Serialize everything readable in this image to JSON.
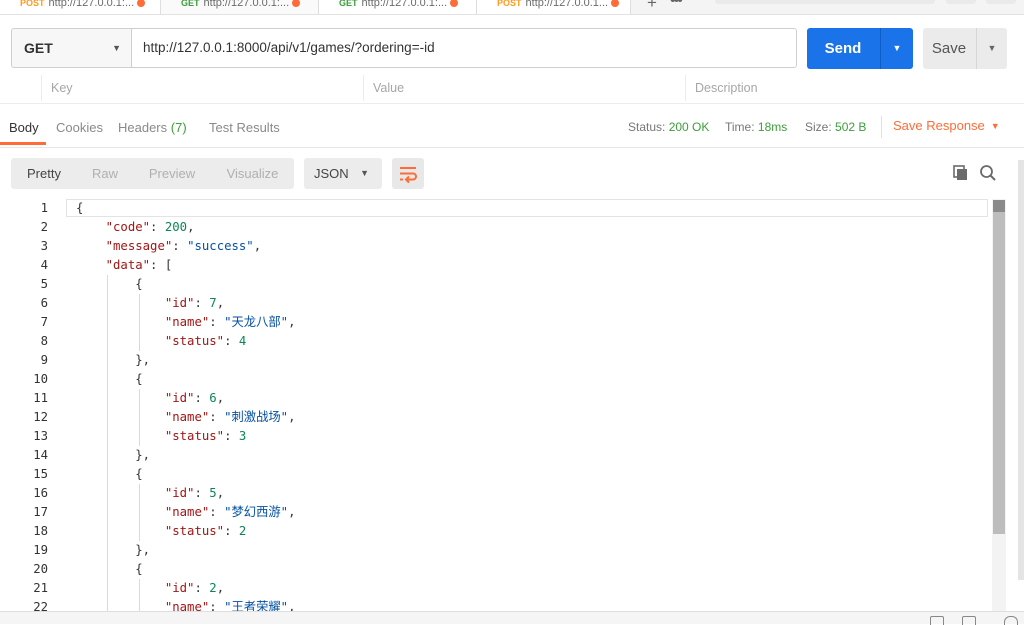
{
  "tabs": [
    {
      "method": "POST",
      "url": "http://127.0.0.1:..."
    },
    {
      "method": "GET",
      "url": "http://127.0.0.1:..."
    },
    {
      "method": "GET",
      "url": "http://127.0.0.1:..."
    },
    {
      "method": "POST",
      "url": "http://127.0.0.1..."
    }
  ],
  "tab_add": "+",
  "tab_more": "•••",
  "request": {
    "method": "GET",
    "url": "http://127.0.0.1:8000/api/v1/games/?ordering=-id",
    "send_label": "Send",
    "save_label": "Save"
  },
  "params": {
    "key_placeholder": "Key",
    "value_placeholder": "Value",
    "description_placeholder": "Description"
  },
  "response_tabs": [
    {
      "label": "Body"
    },
    {
      "label": "Cookies"
    },
    {
      "label": "Headers",
      "count": "(7)"
    },
    {
      "label": "Test Results"
    }
  ],
  "response_meta": {
    "status_label": "Status:",
    "status_value": "200 OK",
    "time_label": "Time:",
    "time_value": "18ms",
    "size_label": "Size:",
    "size_value": "502 B",
    "save_response": "Save Response"
  },
  "view_modes": [
    "Pretty",
    "Raw",
    "Preview",
    "Visualize"
  ],
  "format": "JSON",
  "code_lines": [
    [
      {
        "t": "p",
        "v": "{"
      }
    ],
    [
      {
        "t": "p",
        "v": "    "
      },
      {
        "t": "k",
        "v": "\"code\""
      },
      {
        "t": "p",
        "v": ": "
      },
      {
        "t": "n",
        "v": "200"
      },
      {
        "t": "p",
        "v": ","
      }
    ],
    [
      {
        "t": "p",
        "v": "    "
      },
      {
        "t": "k",
        "v": "\"message\""
      },
      {
        "t": "p",
        "v": ": "
      },
      {
        "t": "s",
        "v": "\"success\""
      },
      {
        "t": "p",
        "v": ","
      }
    ],
    [
      {
        "t": "p",
        "v": "    "
      },
      {
        "t": "k",
        "v": "\"data\""
      },
      {
        "t": "p",
        "v": ": ["
      }
    ],
    [
      {
        "t": "p",
        "v": "        {"
      }
    ],
    [
      {
        "t": "p",
        "v": "            "
      },
      {
        "t": "k",
        "v": "\"id\""
      },
      {
        "t": "p",
        "v": ": "
      },
      {
        "t": "n",
        "v": "7"
      },
      {
        "t": "p",
        "v": ","
      }
    ],
    [
      {
        "t": "p",
        "v": "            "
      },
      {
        "t": "k",
        "v": "\"name\""
      },
      {
        "t": "p",
        "v": ": "
      },
      {
        "t": "s",
        "v": "\"天龙八部\""
      },
      {
        "t": "p",
        "v": ","
      }
    ],
    [
      {
        "t": "p",
        "v": "            "
      },
      {
        "t": "k",
        "v": "\"status\""
      },
      {
        "t": "p",
        "v": ": "
      },
      {
        "t": "n",
        "v": "4"
      }
    ],
    [
      {
        "t": "p",
        "v": "        },"
      }
    ],
    [
      {
        "t": "p",
        "v": "        {"
      }
    ],
    [
      {
        "t": "p",
        "v": "            "
      },
      {
        "t": "k",
        "v": "\"id\""
      },
      {
        "t": "p",
        "v": ": "
      },
      {
        "t": "n",
        "v": "6"
      },
      {
        "t": "p",
        "v": ","
      }
    ],
    [
      {
        "t": "p",
        "v": "            "
      },
      {
        "t": "k",
        "v": "\"name\""
      },
      {
        "t": "p",
        "v": ": "
      },
      {
        "t": "s",
        "v": "\"刺激战场\""
      },
      {
        "t": "p",
        "v": ","
      }
    ],
    [
      {
        "t": "p",
        "v": "            "
      },
      {
        "t": "k",
        "v": "\"status\""
      },
      {
        "t": "p",
        "v": ": "
      },
      {
        "t": "n",
        "v": "3"
      }
    ],
    [
      {
        "t": "p",
        "v": "        },"
      }
    ],
    [
      {
        "t": "p",
        "v": "        {"
      }
    ],
    [
      {
        "t": "p",
        "v": "            "
      },
      {
        "t": "k",
        "v": "\"id\""
      },
      {
        "t": "p",
        "v": ": "
      },
      {
        "t": "n",
        "v": "5"
      },
      {
        "t": "p",
        "v": ","
      }
    ],
    [
      {
        "t": "p",
        "v": "            "
      },
      {
        "t": "k",
        "v": "\"name\""
      },
      {
        "t": "p",
        "v": ": "
      },
      {
        "t": "s",
        "v": "\"梦幻西游\""
      },
      {
        "t": "p",
        "v": ","
      }
    ],
    [
      {
        "t": "p",
        "v": "            "
      },
      {
        "t": "k",
        "v": "\"status\""
      },
      {
        "t": "p",
        "v": ": "
      },
      {
        "t": "n",
        "v": "2"
      }
    ],
    [
      {
        "t": "p",
        "v": "        },"
      }
    ],
    [
      {
        "t": "p",
        "v": "        {"
      }
    ],
    [
      {
        "t": "p",
        "v": "            "
      },
      {
        "t": "k",
        "v": "\"id\""
      },
      {
        "t": "p",
        "v": ": "
      },
      {
        "t": "n",
        "v": "2"
      },
      {
        "t": "p",
        "v": ","
      }
    ],
    [
      {
        "t": "p",
        "v": "            "
      },
      {
        "t": "k",
        "v": "\"name\""
      },
      {
        "t": "p",
        "v": ": "
      },
      {
        "t": "s",
        "v": "\"王者荣耀\""
      },
      {
        "t": "p",
        "v": ","
      }
    ]
  ],
  "colors": {
    "accent": "#ff6c37",
    "send": "#1a73e8",
    "success": "#3c9e3c",
    "json_key": "#a31515",
    "json_string": "#0451a5",
    "json_number": "#098658"
  }
}
